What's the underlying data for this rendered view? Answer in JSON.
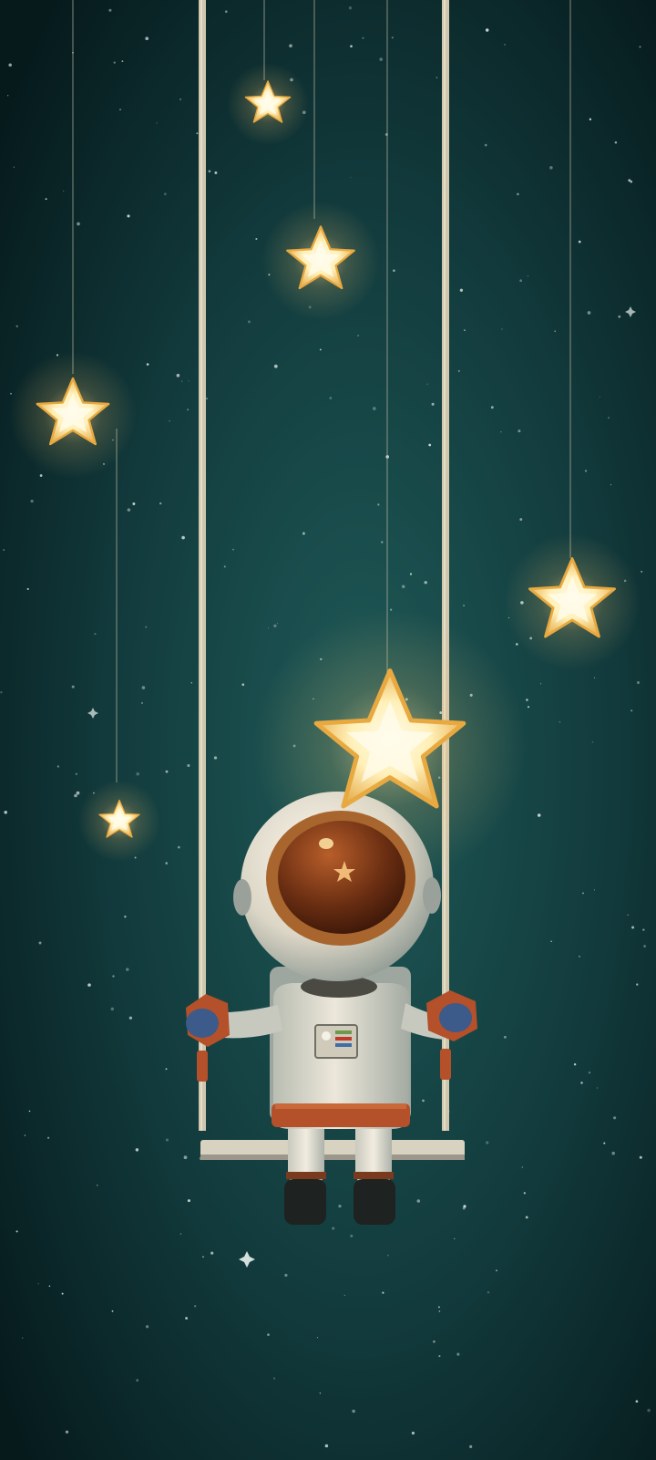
{
  "scene": {
    "subject": "astronaut-on-swing",
    "colors": {
      "sky_center": "#1f5a58",
      "sky_edge": "#061a1c",
      "star_glow": "#ffd98a",
      "star_core": "#fff2c4",
      "star_edge": "#e6a63c",
      "suit": "#e9e4d6",
      "suit_shadow": "#9aa6a0",
      "visor": "#7a3a18",
      "visor_rim": "#a8652e",
      "accent_orange": "#b4502a",
      "glove_blue": "#3c5a8a",
      "rope": "#cfc6ae",
      "seat": "#d8d2c0",
      "boots": "#1e2220"
    },
    "hanging_stars": [
      {
        "name": "hanging-star-top",
        "brightness": 0.9
      },
      {
        "name": "hanging-star-upper",
        "brightness": 1.0
      },
      {
        "name": "hanging-star-left",
        "brightness": 1.0
      },
      {
        "name": "hanging-star-right",
        "brightness": 1.0
      },
      {
        "name": "hanging-star-center",
        "brightness": 1.0
      },
      {
        "name": "hanging-star-small-left",
        "brightness": 0.85
      }
    ]
  }
}
